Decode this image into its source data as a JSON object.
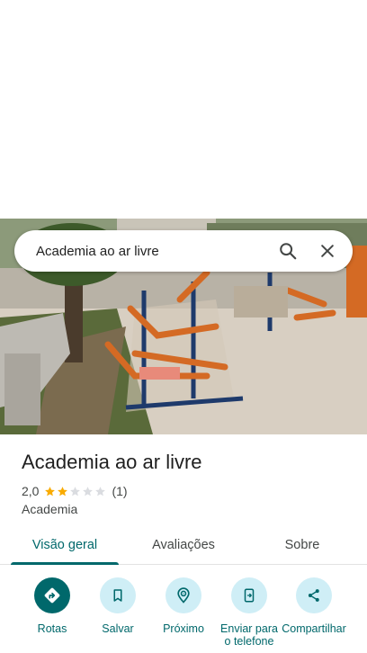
{
  "search": {
    "query": "Academia ao ar livre"
  },
  "place": {
    "title": "Academia ao ar livre",
    "rating": "2,0",
    "rating_value": 2,
    "rating_max": 5,
    "review_count": "(1)",
    "category": "Academia"
  },
  "tabs": [
    {
      "label": "Visão geral",
      "active": true
    },
    {
      "label": "Avaliações",
      "active": false
    },
    {
      "label": "Sobre",
      "active": false
    }
  ],
  "actions": [
    {
      "label": "Rotas",
      "icon": "directions-icon",
      "primary": true
    },
    {
      "label": "Salvar",
      "icon": "bookmark-icon",
      "primary": false
    },
    {
      "label": "Próximo",
      "icon": "nearby-icon",
      "primary": false
    },
    {
      "label": "Enviar para o telefone",
      "icon": "send-to-phone-icon",
      "primary": false
    },
    {
      "label": "Compartilhar",
      "icon": "share-icon",
      "primary": false
    }
  ],
  "colors": {
    "accent": "#00686b",
    "action_bg": "#cfeef6",
    "star_filled": "#f9ab00",
    "star_empty": "#dadce0"
  }
}
